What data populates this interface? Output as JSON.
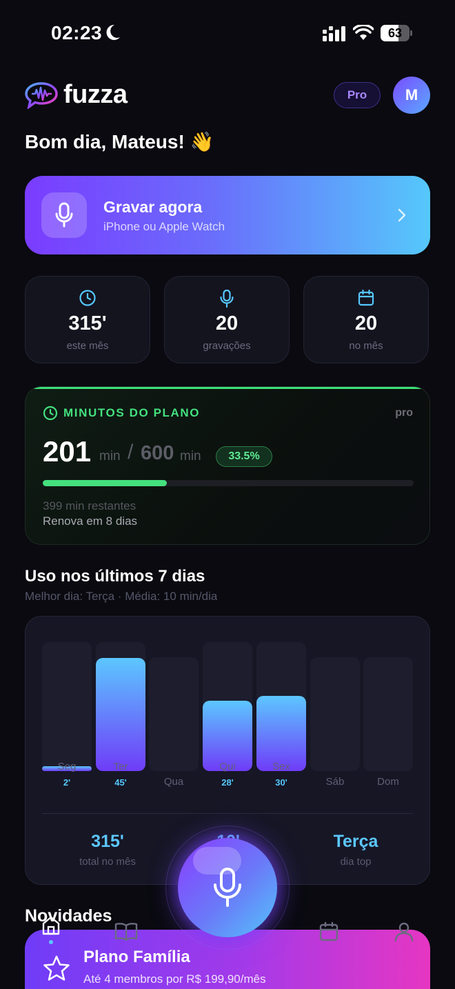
{
  "status_bar": {
    "time": "02:23",
    "battery": "63",
    "battery_level": 0.63
  },
  "header": {
    "app_name": "fuzza",
    "plan_badge": "Pro",
    "avatar_initial": "M"
  },
  "greeting": "Bom dia, Mateus! 👋",
  "record": {
    "title": "Gravar agora",
    "subtitle": "iPhone ou Apple Watch"
  },
  "stats": [
    {
      "icon": "clock-icon",
      "value": "315'",
      "label": "este mês"
    },
    {
      "icon": "mic-icon",
      "value": "20",
      "label": "gravações"
    },
    {
      "icon": "calendar-icon",
      "value": "20",
      "label": "no mês"
    }
  ],
  "plan": {
    "heading": "MINUTOS DO PLANO",
    "tier": "pro",
    "used": "201",
    "used_unit": "min",
    "separator": "/",
    "total": "600",
    "total_unit": "min",
    "percent": "33.5%",
    "progress": 0.335,
    "remaining": "399 min restantes",
    "renew": "Renova em 8 dias"
  },
  "usage": {
    "title": "Uso nos últimos 7 dias",
    "subtitle": "Melhor dia: Terça · Média: 10 min/dia",
    "days": [
      {
        "day": "Seg",
        "value": "2'",
        "minutes": 2,
        "has_value": true
      },
      {
        "day": "Ter",
        "value": "45'",
        "minutes": 45,
        "has_value": true
      },
      {
        "day": "Qua",
        "value": "",
        "minutes": 0,
        "has_value": false
      },
      {
        "day": "Qui",
        "value": "28'",
        "minutes": 28,
        "has_value": true
      },
      {
        "day": "Sex",
        "value": "30'",
        "minutes": 30,
        "has_value": true
      },
      {
        "day": "Sáb",
        "value": "",
        "minutes": 0,
        "has_value": false
      },
      {
        "day": "Dom",
        "value": "",
        "minutes": 0,
        "has_value": false
      }
    ],
    "max_minutes": 45,
    "summary": [
      {
        "value": "315'",
        "label": "total no mês"
      },
      {
        "value": "10'",
        "label": ""
      },
      {
        "value": "Terça",
        "label": "dia top"
      }
    ]
  },
  "news": {
    "title": "Novidades",
    "card_title": "Plano Família",
    "card_subtitle": "Até 4 membros por R$ 199,90/mês"
  },
  "tabs": [
    "home-icon",
    "book-icon",
    "mic-icon",
    "calendar-icon",
    "person-icon"
  ],
  "colors": {
    "accent_blue": "#5cc7ff",
    "accent_purple": "#6f3cf8",
    "plan_green": "#44e07e"
  }
}
